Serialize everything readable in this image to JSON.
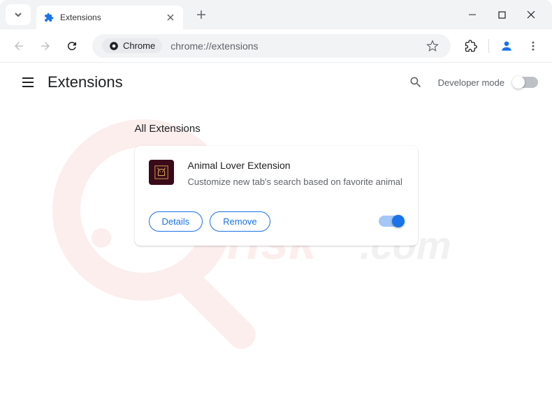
{
  "tab": {
    "title": "Extensions"
  },
  "address": {
    "chip": "Chrome",
    "url": "chrome://extensions"
  },
  "page": {
    "title": "Extensions",
    "dev_mode_label": "Developer mode"
  },
  "section": {
    "title": "All Extensions"
  },
  "extension": {
    "name": "Animal Lover Extension",
    "description": "Customize new tab's search based on favorite animal",
    "details_label": "Details",
    "remove_label": "Remove"
  }
}
